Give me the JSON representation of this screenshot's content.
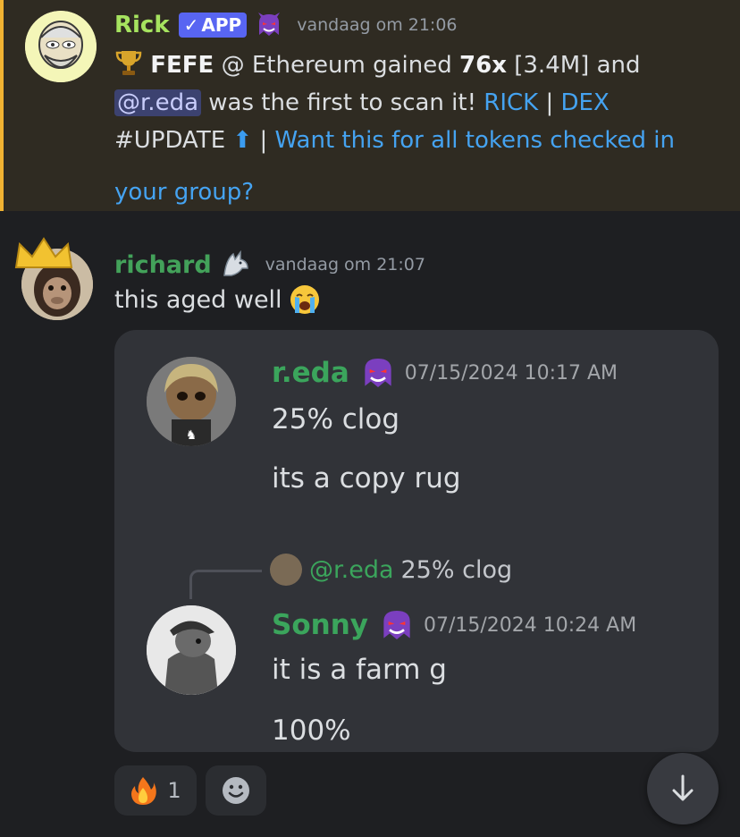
{
  "message1": {
    "username": "Rick",
    "badge_label": "APP",
    "badge_check": "✓",
    "timestamp": "vandaag om 21:06",
    "body": {
      "trophy_icon": "trophy-icon",
      "token_name": "FEFE",
      "part1": " @ Ethereum gained ",
      "gain": "76x",
      "part2": " [3.4M] and",
      "mention": "@r.eda",
      "part3": " was the first to scan it! ",
      "link_rick": "RICK",
      "sep1": " | ",
      "link_dex": "DEX",
      "hashtag": "#UPDATE ",
      "arrow": "⬆",
      "sep2": " | ",
      "link_want_a": "Want this for all tokens checked in",
      "link_want_b": "your group?"
    }
  },
  "message2": {
    "username": "richard",
    "timestamp": "vandaag om 21:07",
    "text": "this aged well"
  },
  "embed": {
    "msg_a": {
      "username": "r.eda",
      "timestamp": "07/15/2024 10:17 AM",
      "lines": [
        "25% clog",
        "its a copy rug"
      ]
    },
    "reply": {
      "mention": "@r.eda",
      "text": "25% clog"
    },
    "msg_b": {
      "username": "Sonny",
      "timestamp": "07/15/2024 10:24 AM",
      "lines": [
        "it is a farm g",
        "100%"
      ]
    }
  },
  "reactions": [
    {
      "icon": "fire-icon",
      "count": "1"
    }
  ],
  "colors": {
    "rick": "#a6e35f",
    "richard": "#43a25a",
    "link": "#45a3f1",
    "highlight_border": "#f0b232",
    "app_badge": "#5865f2"
  }
}
